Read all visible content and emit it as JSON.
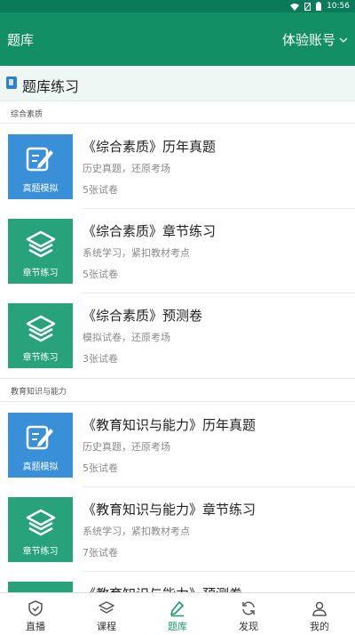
{
  "status": {
    "time": "10:56"
  },
  "appbar": {
    "title": "题库",
    "account": "体验账号"
  },
  "section": {
    "title": "题库练习"
  },
  "groups": [
    {
      "label": "综合素质",
      "items": [
        {
          "title": "《综合素质》历年真题",
          "desc": "历史真题，还原考场",
          "count": "5张试卷",
          "badge": "真题模拟",
          "icon": "edit-icon",
          "color": "#3a8fd9"
        },
        {
          "title": "《综合素质》章节练习",
          "desc": "系统学习，紧扣教材考点",
          "count": "5张试卷",
          "badge": "章节练习",
          "icon": "layers-icon",
          "color": "#27a27a"
        },
        {
          "title": "《综合素质》预测卷",
          "desc": "模拟试卷，还原考场",
          "count": "3张试卷",
          "badge": "章节练习",
          "icon": "layers-icon",
          "color": "#27a27a"
        }
      ]
    },
    {
      "label": "教育知识与能力",
      "items": [
        {
          "title": "《教育知识与能力》历年真题",
          "desc": "历史真题，还原考场",
          "count": "5张试卷",
          "badge": "真题模拟",
          "icon": "edit-icon",
          "color": "#3a8fd9"
        },
        {
          "title": "《教育知识与能力》章节练习",
          "desc": "系统学习，紧扣教材考点",
          "count": "7张试卷",
          "badge": "章节练习",
          "icon": "layers-icon",
          "color": "#27a27a"
        },
        {
          "title": "《教育知识与能力》预测卷",
          "desc": "",
          "count": "",
          "badge": "",
          "icon": "layers-icon",
          "color": "#27a27a"
        }
      ]
    }
  ],
  "tabs": [
    {
      "label": "直播",
      "icon": "shield-icon",
      "active": false
    },
    {
      "label": "课程",
      "icon": "layers-icon",
      "active": false
    },
    {
      "label": "题库",
      "icon": "pencil-icon",
      "active": true
    },
    {
      "label": "发现",
      "icon": "refresh-icon",
      "active": false
    },
    {
      "label": "我的",
      "icon": "user-icon",
      "active": false
    }
  ],
  "colors": {
    "primary": "#138f66",
    "statusbar": "#0b7a59",
    "active_tab": "#1a9a6c"
  }
}
